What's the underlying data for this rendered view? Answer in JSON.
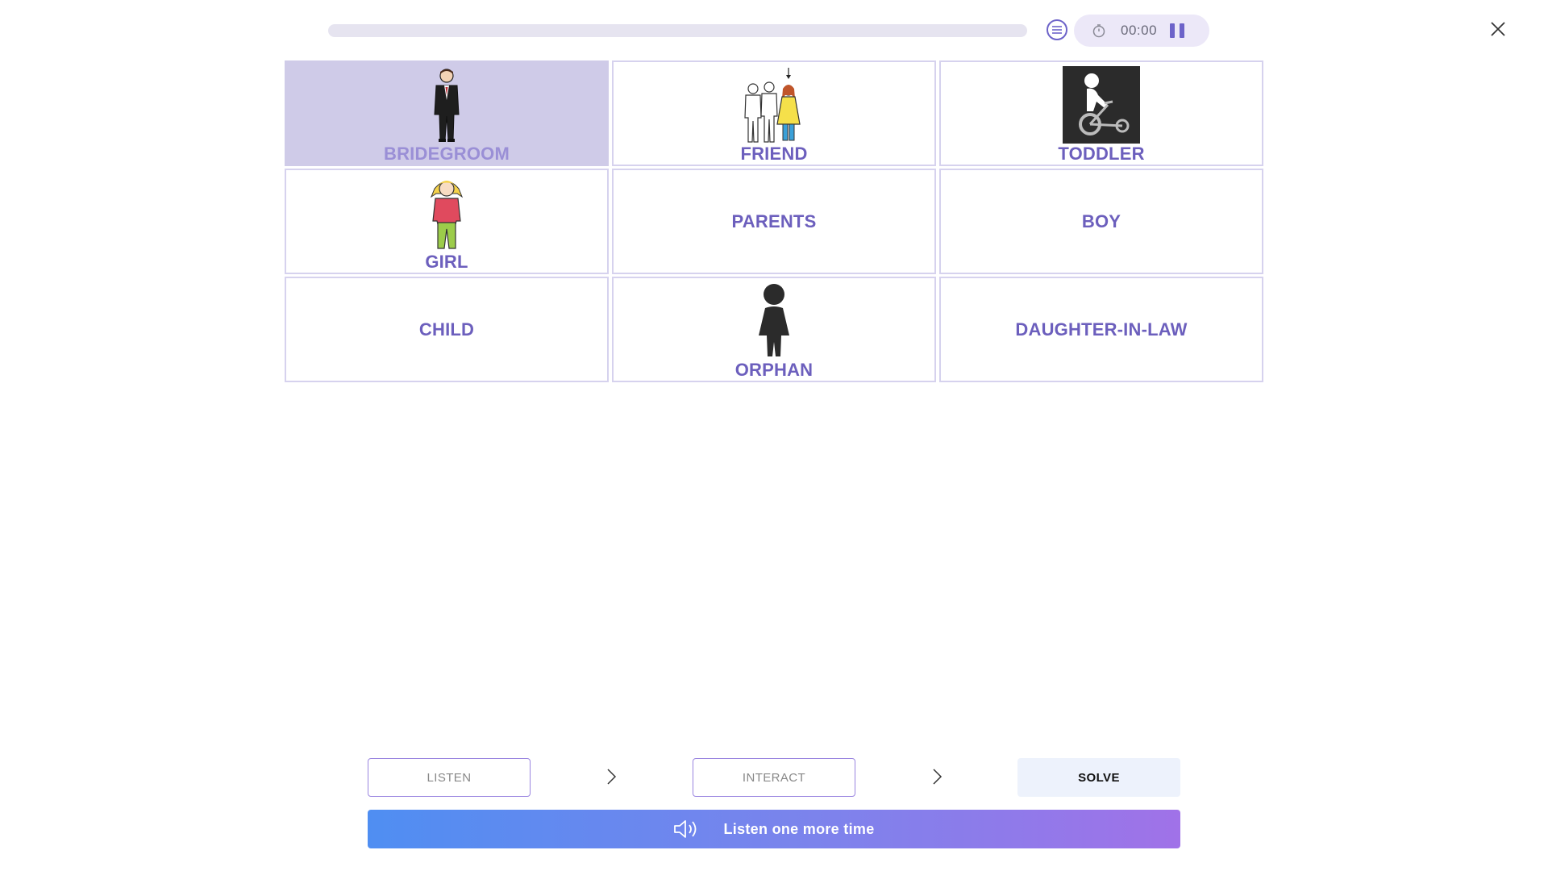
{
  "progress": {
    "fraction": 0
  },
  "timer": {
    "time": "00:00"
  },
  "accent_color": "#6c5fbd",
  "cards": [
    {
      "label": "BRIDEGROOM",
      "icon": "bridegroom-icon",
      "selected": true
    },
    {
      "label": "FRIEND",
      "icon": "friend-icon",
      "selected": false
    },
    {
      "label": "TODDLER",
      "icon": "toddler-icon",
      "selected": false
    },
    {
      "label": "GIRL",
      "icon": "girl-icon",
      "selected": false
    },
    {
      "label": "PARENTS",
      "icon": "",
      "selected": false
    },
    {
      "label": "BOY",
      "icon": "",
      "selected": false
    },
    {
      "label": "CHILD",
      "icon": "",
      "selected": false
    },
    {
      "label": "ORPHAN",
      "icon": "orphan-icon",
      "selected": false
    },
    {
      "label": "DAUGHTER-IN-LAW",
      "icon": "",
      "selected": false
    }
  ],
  "steps": {
    "listen": "LISTEN",
    "interact": "INTERACT",
    "solve": "SOLVE"
  },
  "listen_again": {
    "label": "Listen one more time",
    "icon": "speaker-icon"
  }
}
